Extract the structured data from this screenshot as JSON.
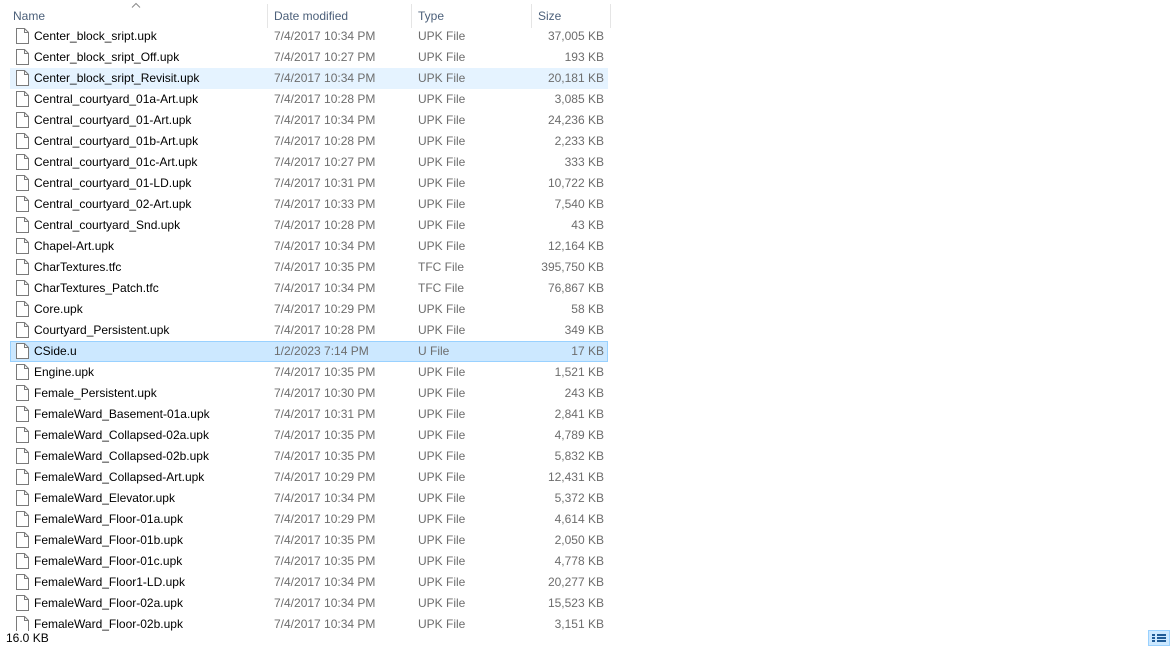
{
  "columns": {
    "name": "Name",
    "date": "Date modified",
    "type": "Type",
    "size": "Size"
  },
  "files": [
    {
      "name": "Center_block_sript.upk",
      "date": "7/4/2017 10:34 PM",
      "type": "UPK File",
      "size": "37,005 KB",
      "state": "normal"
    },
    {
      "name": "Center_block_sript_Off.upk",
      "date": "7/4/2017 10:27 PM",
      "type": "UPK File",
      "size": "193 KB",
      "state": "normal"
    },
    {
      "name": "Center_block_sript_Revisit.upk",
      "date": "7/4/2017 10:34 PM",
      "type": "UPK File",
      "size": "20,181 KB",
      "state": "hover"
    },
    {
      "name": "Central_courtyard_01a-Art.upk",
      "date": "7/4/2017 10:28 PM",
      "type": "UPK File",
      "size": "3,085 KB",
      "state": "normal"
    },
    {
      "name": "Central_courtyard_01-Art.upk",
      "date": "7/4/2017 10:34 PM",
      "type": "UPK File",
      "size": "24,236 KB",
      "state": "normal"
    },
    {
      "name": "Central_courtyard_01b-Art.upk",
      "date": "7/4/2017 10:28 PM",
      "type": "UPK File",
      "size": "2,233 KB",
      "state": "normal"
    },
    {
      "name": "Central_courtyard_01c-Art.upk",
      "date": "7/4/2017 10:27 PM",
      "type": "UPK File",
      "size": "333 KB",
      "state": "normal"
    },
    {
      "name": "Central_courtyard_01-LD.upk",
      "date": "7/4/2017 10:31 PM",
      "type": "UPK File",
      "size": "10,722 KB",
      "state": "normal"
    },
    {
      "name": "Central_courtyard_02-Art.upk",
      "date": "7/4/2017 10:33 PM",
      "type": "UPK File",
      "size": "7,540 KB",
      "state": "normal"
    },
    {
      "name": "Central_courtyard_Snd.upk",
      "date": "7/4/2017 10:28 PM",
      "type": "UPK File",
      "size": "43 KB",
      "state": "normal"
    },
    {
      "name": "Chapel-Art.upk",
      "date": "7/4/2017 10:34 PM",
      "type": "UPK File",
      "size": "12,164 KB",
      "state": "normal"
    },
    {
      "name": "CharTextures.tfc",
      "date": "7/4/2017 10:35 PM",
      "type": "TFC File",
      "size": "395,750 KB",
      "state": "normal"
    },
    {
      "name": "CharTextures_Patch.tfc",
      "date": "7/4/2017 10:34 PM",
      "type": "TFC File",
      "size": "76,867 KB",
      "state": "normal"
    },
    {
      "name": "Core.upk",
      "date": "7/4/2017 10:29 PM",
      "type": "UPK File",
      "size": "58 KB",
      "state": "normal"
    },
    {
      "name": "Courtyard_Persistent.upk",
      "date": "7/4/2017 10:28 PM",
      "type": "UPK File",
      "size": "349 KB",
      "state": "normal"
    },
    {
      "name": "CSide.u",
      "date": "1/2/2023 7:14 PM",
      "type": "U File",
      "size": "17 KB",
      "state": "selected"
    },
    {
      "name": "Engine.upk",
      "date": "7/4/2017 10:35 PM",
      "type": "UPK File",
      "size": "1,521 KB",
      "state": "normal"
    },
    {
      "name": "Female_Persistent.upk",
      "date": "7/4/2017 10:30 PM",
      "type": "UPK File",
      "size": "243 KB",
      "state": "normal"
    },
    {
      "name": "FemaleWard_Basement-01a.upk",
      "date": "7/4/2017 10:31 PM",
      "type": "UPK File",
      "size": "2,841 KB",
      "state": "normal"
    },
    {
      "name": "FemaleWard_Collapsed-02a.upk",
      "date": "7/4/2017 10:35 PM",
      "type": "UPK File",
      "size": "4,789 KB",
      "state": "normal"
    },
    {
      "name": "FemaleWard_Collapsed-02b.upk",
      "date": "7/4/2017 10:35 PM",
      "type": "UPK File",
      "size": "5,832 KB",
      "state": "normal"
    },
    {
      "name": "FemaleWard_Collapsed-Art.upk",
      "date": "7/4/2017 10:29 PM",
      "type": "UPK File",
      "size": "12,431 KB",
      "state": "normal"
    },
    {
      "name": "FemaleWard_Elevator.upk",
      "date": "7/4/2017 10:34 PM",
      "type": "UPK File",
      "size": "5,372 KB",
      "state": "normal"
    },
    {
      "name": "FemaleWard_Floor-01a.upk",
      "date": "7/4/2017 10:29 PM",
      "type": "UPK File",
      "size": "4,614 KB",
      "state": "normal"
    },
    {
      "name": "FemaleWard_Floor-01b.upk",
      "date": "7/4/2017 10:35 PM",
      "type": "UPK File",
      "size": "2,050 KB",
      "state": "normal"
    },
    {
      "name": "FemaleWard_Floor-01c.upk",
      "date": "7/4/2017 10:35 PM",
      "type": "UPK File",
      "size": "4,778 KB",
      "state": "normal"
    },
    {
      "name": "FemaleWard_Floor1-LD.upk",
      "date": "7/4/2017 10:34 PM",
      "type": "UPK File",
      "size": "20,277 KB",
      "state": "normal"
    },
    {
      "name": "FemaleWard_Floor-02a.upk",
      "date": "7/4/2017 10:34 PM",
      "type": "UPK File",
      "size": "15,523 KB",
      "state": "normal"
    },
    {
      "name": "FemaleWard_Floor-02b.upk",
      "date": "7/4/2017 10:34 PM",
      "type": "UPK File",
      "size": "3,151 KB",
      "state": "normal"
    }
  ],
  "status": {
    "selection_size": "16.0 KB"
  },
  "icons": {
    "file": "file-icon",
    "sort": "sort-up-icon",
    "view": "details-view-icon"
  },
  "colors": {
    "selected_bg": "#cce8ff",
    "selected_border": "#99d1ff",
    "hover_bg": "#e5f3ff",
    "header_text": "#4c607a",
    "secondary_text": "#6d6d6d"
  }
}
